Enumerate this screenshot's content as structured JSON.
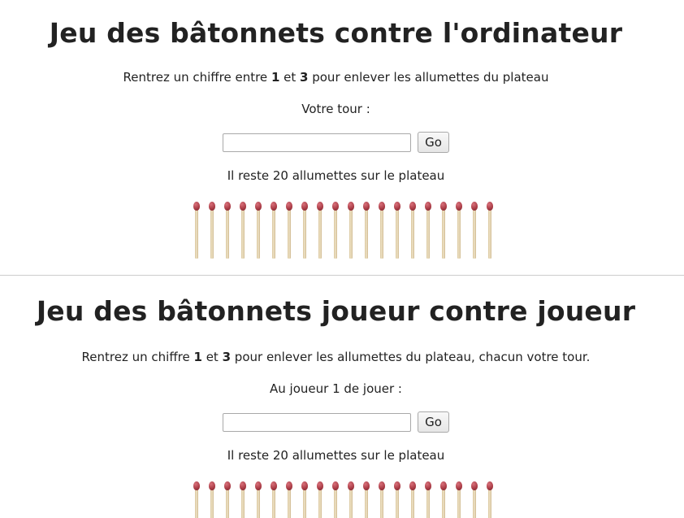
{
  "games": [
    {
      "title": "Jeu des bâtonnets contre l'ordinateur",
      "instructions": {
        "before": "Rentrez un chiffre entre ",
        "min": "1",
        "middle": " et ",
        "max": "3",
        "after": " pour enlever les allumettes du plateau"
      },
      "turn_label": "Votre tour :",
      "input_value": "",
      "button_label": "Go",
      "remaining_text": "Il reste 20 allumettes sur le plateau",
      "match_count": 20
    },
    {
      "title": "Jeu des bâtonnets joueur contre joueur",
      "instructions": {
        "before": "Rentrez un chiffre ",
        "min": "1",
        "middle": " et ",
        "max": "3",
        "after": " pour enlever les allumettes du plateau, chacun votre tour."
      },
      "turn_label": "Au joueur 1 de jouer :",
      "input_value": "",
      "button_label": "Go",
      "remaining_text": "Il reste 20 allumettes sur le plateau",
      "match_count": 20
    }
  ],
  "icons": {
    "match": "matchstick-icon"
  },
  "colors": {
    "match_head": "#a83a44",
    "match_stick": "#e8d8b4",
    "divider": "#cccccc"
  }
}
